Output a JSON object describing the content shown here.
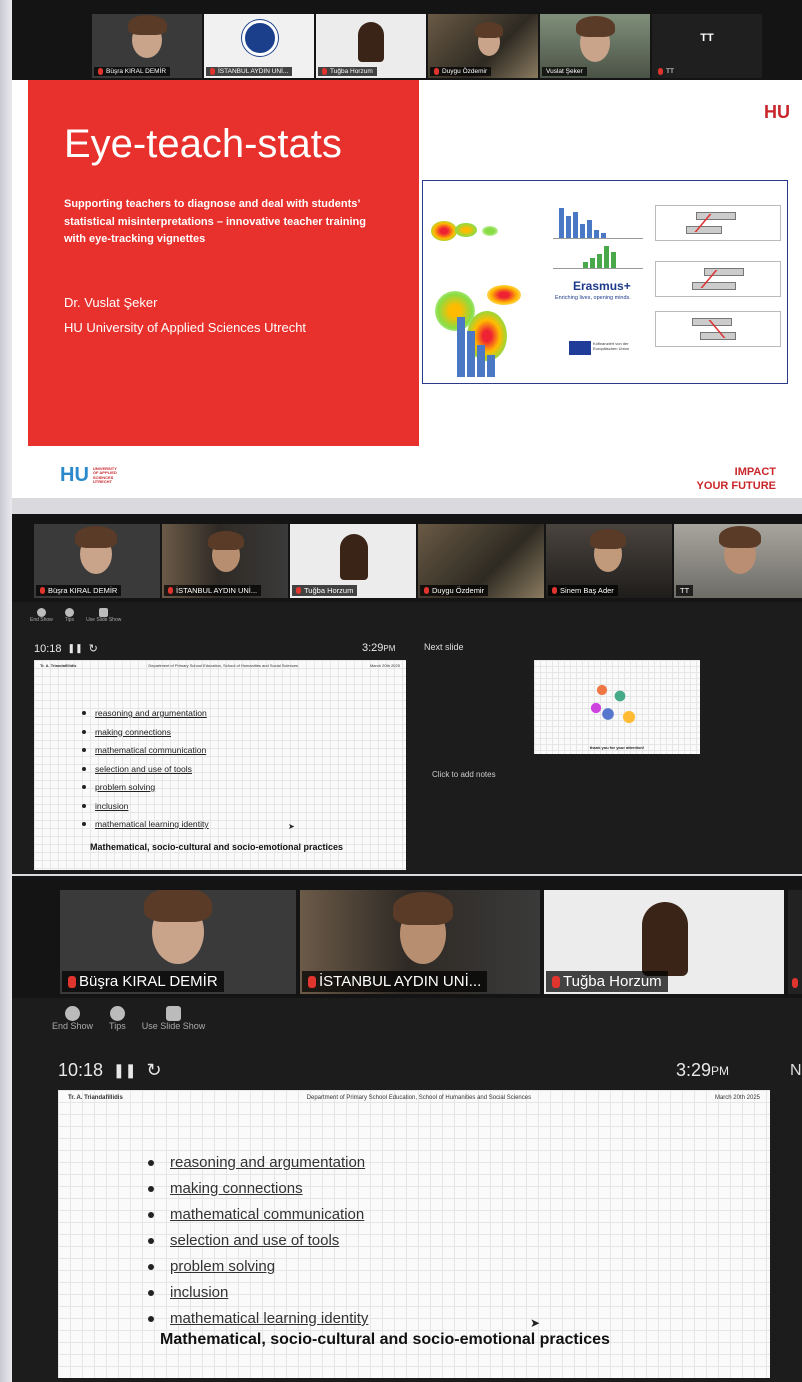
{
  "panel1": {
    "participants": [
      {
        "name": "Büşra KIRAL DEMİR"
      },
      {
        "name": "İSTANBUL AYDIN UNİ..."
      },
      {
        "name": "Tuğba Horzum"
      },
      {
        "name": "Duygu Özdemir"
      },
      {
        "name": "Vuslat Şeker"
      },
      {
        "name": "TT"
      }
    ],
    "tt_avatar": "TT",
    "slide": {
      "title": "Eye-teach-stats",
      "subtitle": "Supporting teachers to diagnose and deal with students’ statistical misinterpretations – innovative teacher training with eye-tracking vignettes",
      "author": "Dr. Vuslat Şeker",
      "affiliation": "HU University of Applied Sciences Utrecht",
      "logo_top": "HU",
      "erasmus": "Erasmus+",
      "erasmus_tagline": "Enriching lives, opening minds.",
      "eu_text": "Kofinanziert von der Europäischen Union",
      "footer_logo": "HU",
      "footer_logo_text": [
        "UNIVERSITY",
        "OF APPLIED",
        "SCIENCES",
        "UTRECHT"
      ],
      "footer_slogan_1": "IMPACT",
      "footer_slogan_2": "YOUR FUTURE",
      "brand_color": "#e8302c"
    }
  },
  "panel2": {
    "participants": [
      {
        "name": "Büşra KIRAL DEMİR"
      },
      {
        "name": "İSTANBUL AYDIN UNİ..."
      },
      {
        "name": "Tuğba Horzum"
      },
      {
        "name": "Duygu Özdemir"
      },
      {
        "name": "Sinem Baş Ader"
      },
      {
        "name": "TT"
      }
    ],
    "toolbar": {
      "end_show": "End Show",
      "tips": "Tips",
      "use_slide_show": "Use Slide Show"
    },
    "timer": "10:18",
    "clock": "3:29",
    "clock_suffix": "PM",
    "next_slide_label": "Next slide",
    "next_slide_caption": "thank you for your attention!",
    "notes_placeholder": "Click to add notes"
  },
  "panel3": {
    "participants": [
      {
        "name": "Büşra KIRAL DEMİR"
      },
      {
        "name": "İSTANBUL AYDIN UNİ..."
      },
      {
        "name": "Tuğba Horzum"
      }
    ],
    "toolbar": {
      "end_show": "End Show",
      "tips": "Tips",
      "use_slide_show": "Use Slide Show"
    },
    "timer": "10:18",
    "clock": "3:29",
    "clock_suffix": "PM",
    "next_initial": "N"
  },
  "slide_content": {
    "header_author": "Tr. A. Triandafillidis",
    "header_dept": "Department of Primary School Education, School of Humanities and Social Sciences",
    "header_date": "March 20th 2025",
    "bullets": [
      "reasoning and argumentation",
      "making connections",
      "mathematical communication",
      "selection and use of tools",
      "problem solving",
      "inclusion",
      "mathematical learning identity"
    ],
    "heading": "Mathematical, socio-cultural and socio-emotional practices"
  }
}
